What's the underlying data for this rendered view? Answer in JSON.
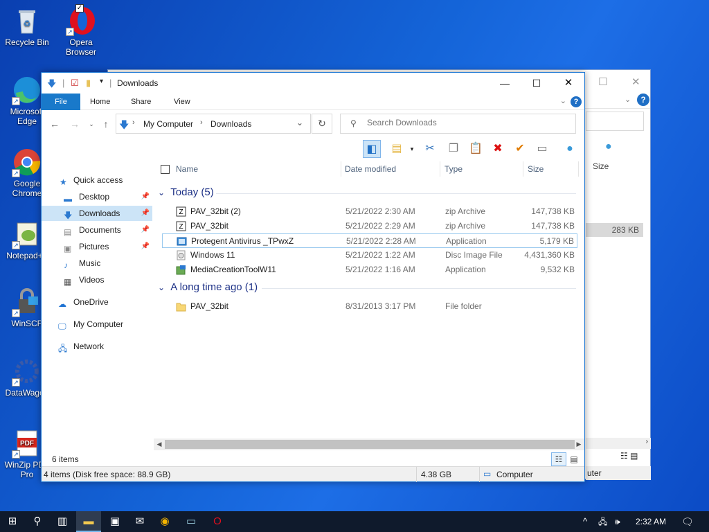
{
  "desktop": {
    "icons": [
      {
        "label": "Recycle Bin",
        "name": "recycle-bin"
      },
      {
        "label": "Opera Browser",
        "name": "opera-browser"
      },
      {
        "label": "Microsoft Edge",
        "name": "edge"
      },
      {
        "label": "Google Chrome",
        "name": "chrome"
      },
      {
        "label": "Notepad++",
        "name": "notepadpp"
      },
      {
        "label": "WinSCP",
        "name": "winscp"
      },
      {
        "label": "DataWagon",
        "name": "datawagon"
      },
      {
        "label": "WinZip PDF Pro",
        "name": "winzip-pdf"
      }
    ]
  },
  "bg_window": {
    "size_header": "Size",
    "selected_size": "283 KB",
    "status_tail": "uter"
  },
  "window": {
    "title": "Downloads",
    "ribbon_tabs": [
      "File",
      "Home",
      "Share",
      "View"
    ],
    "help": "?",
    "address": {
      "crumbs": [
        "My Computer",
        "Downloads"
      ]
    },
    "search_placeholder": "Search Downloads",
    "nav": [
      {
        "label": "Quick access",
        "icon": "star-icon"
      },
      {
        "label": "Desktop",
        "icon": "desktop-icon",
        "pinned": true
      },
      {
        "label": "Downloads",
        "icon": "download-icon",
        "pinned": true,
        "selected": true
      },
      {
        "label": "Documents",
        "icon": "documents-icon",
        "pinned": true
      },
      {
        "label": "Pictures",
        "icon": "pictures-icon",
        "pinned": true
      },
      {
        "label": "Music",
        "icon": "music-icon"
      },
      {
        "label": "Videos",
        "icon": "videos-icon"
      },
      {
        "label": "OneDrive",
        "icon": "cloud-icon"
      },
      {
        "label": "My Computer",
        "icon": "computer-icon"
      },
      {
        "label": "Network",
        "icon": "network-icon"
      }
    ],
    "columns": [
      "Name",
      "Date modified",
      "Type",
      "Size"
    ],
    "groups": [
      {
        "title": "Today (5)",
        "rows": [
          {
            "name": "PAV_32bit (2)",
            "date": "5/21/2022 2:30 AM",
            "type": "zip Archive",
            "size": "147,738 KB",
            "icon": "zip-icon"
          },
          {
            "name": "PAV_32bit",
            "date": "5/21/2022 2:29 AM",
            "type": "zip Archive",
            "size": "147,738 KB",
            "icon": "zip-icon"
          },
          {
            "name": "Protegent Antivirus _TPwxZ",
            "date": "5/21/2022 2:28 AM",
            "type": "Application",
            "size": "5,179 KB",
            "icon": "app-icon"
          },
          {
            "name": "Windows 11",
            "date": "5/21/2022 1:22 AM",
            "type": "Disc Image File",
            "size": "4,431,360 KB",
            "icon": "disc-icon"
          },
          {
            "name": "MediaCreationToolW11",
            "date": "5/21/2022 1:16 AM",
            "type": "Application",
            "size": "9,532 KB",
            "icon": "setup-icon"
          }
        ]
      },
      {
        "title": "A long time ago (1)",
        "rows": [
          {
            "name": "PAV_32bit",
            "date": "8/31/2013 3:17 PM",
            "type": "File folder",
            "size": "",
            "icon": "folder-icon"
          }
        ]
      }
    ],
    "item_count": "6 items",
    "status": {
      "left": "4 items (Disk free space: 88.9 GB)",
      "mid": "4.38 GB",
      "right": "Computer"
    }
  },
  "taskbar": {
    "time": "2:32 AM"
  },
  "colors": {
    "accent": "#1979ca",
    "selected_nav": "#cce4f7",
    "group_title": "#1e3287"
  }
}
